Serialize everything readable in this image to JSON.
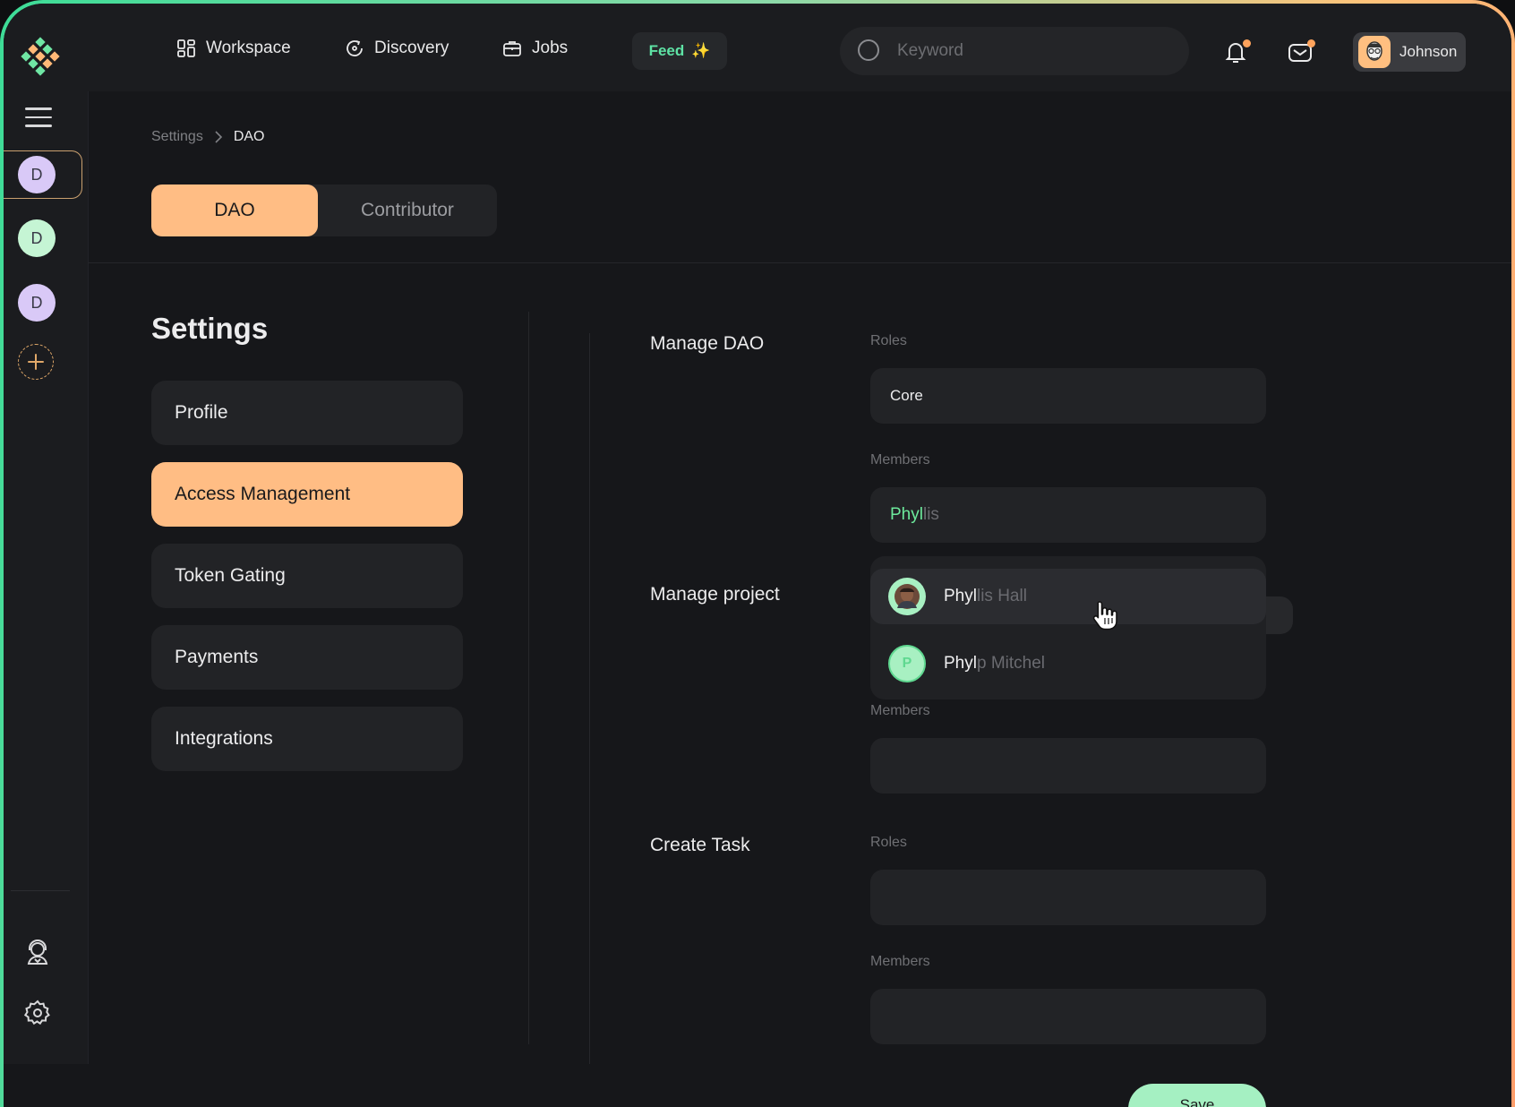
{
  "nav": {
    "items": [
      {
        "label": "Workspace",
        "icon": "grid-icon"
      },
      {
        "label": "Discovery",
        "icon": "discovery-icon"
      },
      {
        "label": "Jobs",
        "icon": "briefcase-icon"
      }
    ],
    "feed_label": "Feed",
    "feed_emoji": "✨",
    "search_placeholder": "Keyword",
    "user_name": "Johnson"
  },
  "sidebar": {
    "daos": [
      {
        "initial": "D",
        "color": "#d9c9f7",
        "active": true
      },
      {
        "initial": "D",
        "color": "#c5f5d4",
        "active": false
      },
      {
        "initial": "D",
        "color": "#d9c9f7",
        "active": false
      }
    ]
  },
  "breadcrumb": {
    "parent": "Settings",
    "current": "DAO"
  },
  "tabs": {
    "active": "DAO",
    "inactive": "Contributor"
  },
  "settings": {
    "title": "Settings",
    "menu": [
      "Profile",
      "Access Management",
      "Token Gating",
      "Payments",
      "Integrations"
    ],
    "active_menu": "Access Management"
  },
  "sections": {
    "manage_dao": {
      "title": "Manage DAO",
      "roles_label": "Roles",
      "roles_value": "Core",
      "members_label": "Members",
      "members_typed": "Phyl",
      "members_suggest": "lis"
    },
    "manage_project": {
      "title": "Manage project",
      "members_label": "Members"
    },
    "create_task": {
      "title": "Create Task",
      "roles_label": "Roles",
      "members_label": "Members"
    }
  },
  "suggestions": [
    {
      "typed": "Phyl",
      "rest": "lis Hall",
      "avatar": "photo"
    },
    {
      "typed": "Phyl",
      "rest": "p Mitchel",
      "avatar": "P"
    }
  ],
  "save_label": "Save",
  "colors": {
    "accent": "#ffbd84",
    "green": "#6dea9c",
    "save": "#a5f0c2"
  }
}
